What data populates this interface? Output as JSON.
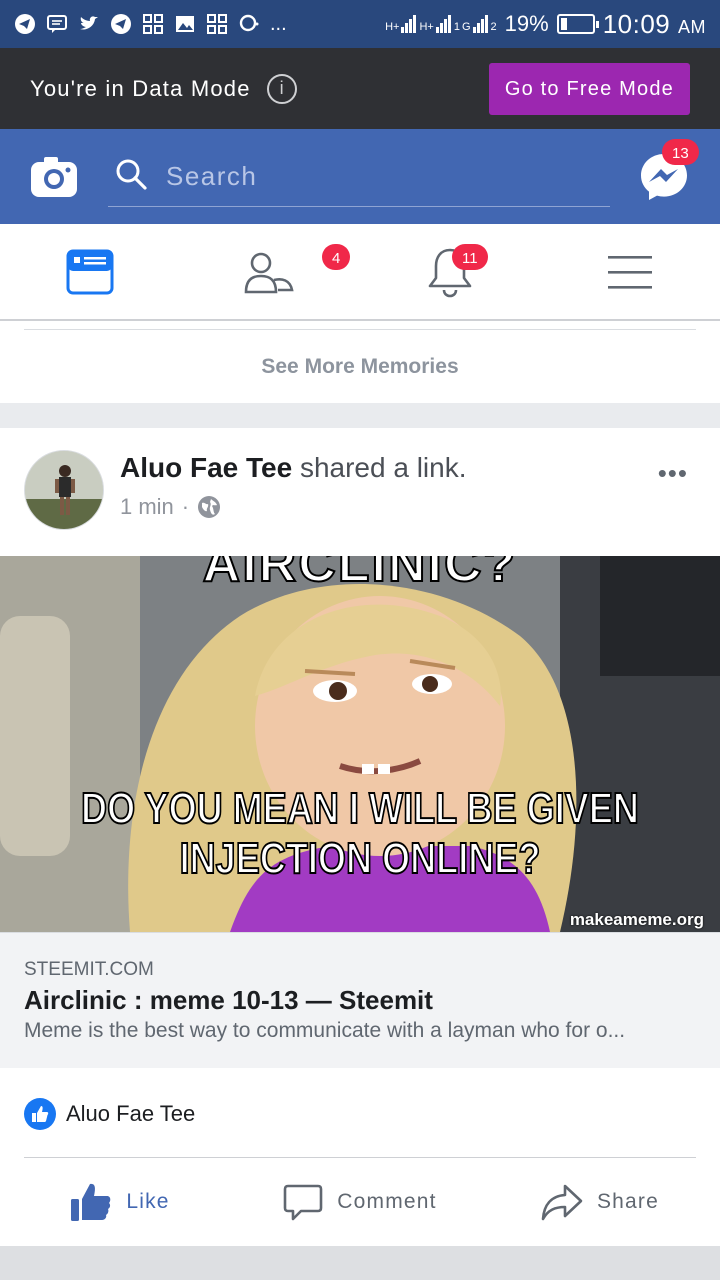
{
  "status_bar": {
    "signal_labels": [
      "H+",
      "H+",
      "1",
      "G",
      "2"
    ],
    "battery": "19%",
    "battery_level": 0.19,
    "time": "10:09",
    "ampm": "AM",
    "more": "..."
  },
  "data_mode": {
    "message": "You're in Data Mode",
    "button": "Go to Free Mode"
  },
  "header": {
    "search_placeholder": "Search",
    "messenger_badge": "13"
  },
  "nav": {
    "friends_badge": "4",
    "notifications_badge": "11"
  },
  "memories": {
    "link": "See More Memories"
  },
  "post": {
    "author": "Aluo Fae Tee",
    "action": " shared a link.",
    "time": "1 min",
    "separator": "·",
    "more": "•••",
    "meme": {
      "top_text": "AIRCLINIC?",
      "bottom_text_line1": "DO YOU MEAN I WILL BE GIVEN",
      "bottom_text_line2": "INJECTION ONLINE?",
      "watermark": "makeameme.org"
    },
    "link": {
      "domain": "STEEMIT.COM",
      "title": "Airclinic : meme 10-13 — Steemit",
      "description": "Meme is the best way to communicate with a layman who for o..."
    },
    "liked_by": "Aluo Fae Tee",
    "actions": {
      "like": "Like",
      "comment": "Comment",
      "share": "Share"
    }
  },
  "colors": {
    "facebook_blue": "#4267b2",
    "status_bar": "#29487d",
    "data_bar": "#2f3034",
    "free_mode_button": "#9c27b0",
    "badge_red": "#f02849"
  }
}
